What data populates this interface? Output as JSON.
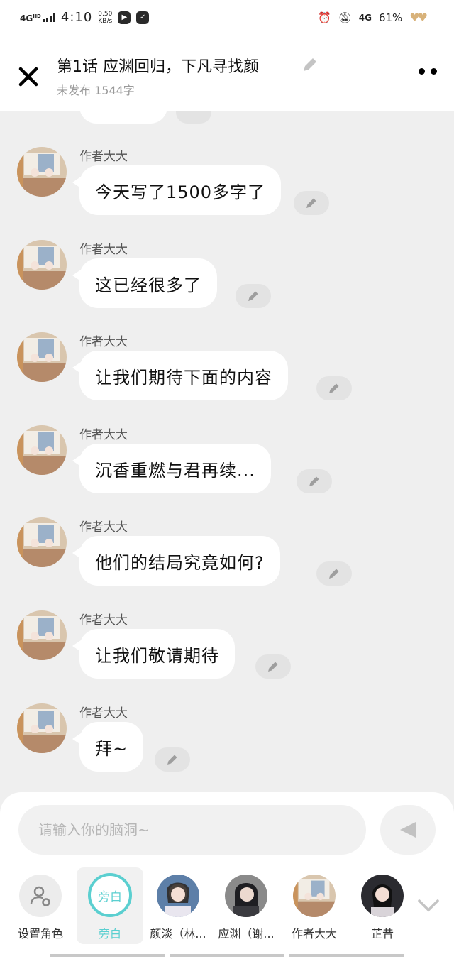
{
  "status_bar": {
    "network": "4G",
    "hd": "HD",
    "time": "4:10",
    "speed_value": "0.50",
    "speed_unit": "KB/s",
    "network_right": "4G",
    "battery": "61%"
  },
  "header": {
    "title": "第1话 应渊回归，下凡寻找颜",
    "subtitle": "未发布 1544字"
  },
  "messages": [
    {
      "sender": "作者大大",
      "text": "今天写了1500多字了"
    },
    {
      "sender": "作者大大",
      "text": "这已经很多了"
    },
    {
      "sender": "作者大大",
      "text": "让我们期待下面的内容"
    },
    {
      "sender": "作者大大",
      "text": "沉香重燃与君再续..."
    },
    {
      "sender": "作者大大",
      "text": "他们的结局究竟如何?"
    },
    {
      "sender": "作者大大",
      "text": "让我们敬请期待"
    },
    {
      "sender": "作者大大",
      "text": "拜~"
    }
  ],
  "input": {
    "placeholder": "请输入你的脑洞~"
  },
  "roles": [
    {
      "name": "设置角色"
    },
    {
      "name": "旁白",
      "badge": "旁白"
    },
    {
      "name": "颜淡（林..."
    },
    {
      "name": "应渊（谢..."
    },
    {
      "name": "作者大大"
    },
    {
      "name": "芷昔"
    }
  ],
  "colors": {
    "accent": "#5bcfd0",
    "background": "#efefef",
    "bubble": "#ffffff"
  }
}
